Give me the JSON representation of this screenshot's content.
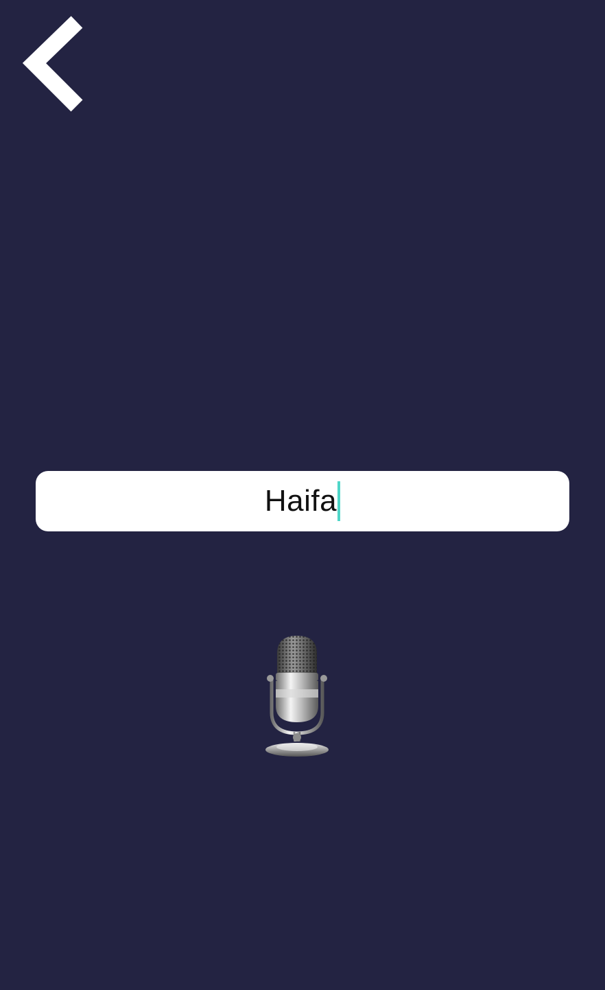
{
  "header": {
    "back_icon": "chevron-left-icon"
  },
  "search": {
    "value": "Haifa"
  },
  "voice": {
    "mic_icon": "microphone-icon"
  },
  "colors": {
    "background": "#232342",
    "input_background": "#ffffff",
    "caret": "#4fd6c8",
    "icon": "#ffffff"
  }
}
